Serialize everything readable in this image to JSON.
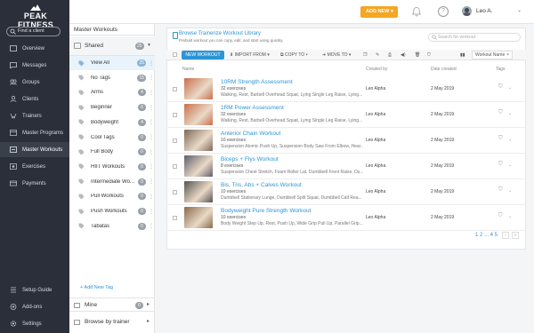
{
  "brand": {
    "name": "PEAK FITNESS",
    "accent": "#f5a623",
    "link": "#2c95d6",
    "sidebar_bg": "#2b2f3a"
  },
  "header": {
    "add_new_label": "ADD NEW",
    "user_name": "Leo A."
  },
  "sidebar": {
    "find_placeholder": "Find a client",
    "items": [
      {
        "label": "Overview",
        "icon": "overview-icon"
      },
      {
        "label": "Messages",
        "icon": "messages-icon"
      },
      {
        "label": "Groups",
        "icon": "groups-icon"
      },
      {
        "label": "Clients",
        "icon": "clients-icon"
      },
      {
        "label": "Trainers",
        "icon": "trainers-icon"
      },
      {
        "label": "Master Programs",
        "icon": "programs-icon"
      },
      {
        "label": "Master Workouts",
        "icon": "workouts-icon"
      },
      {
        "label": "Exercises",
        "icon": "exercises-icon"
      },
      {
        "label": "Payments",
        "icon": "payments-icon"
      }
    ],
    "bottom": [
      {
        "label": "Setup Guide",
        "icon": "setup-guide-icon"
      },
      {
        "label": "Add-ons",
        "icon": "addons-icon"
      },
      {
        "label": "Settings",
        "icon": "settings-icon"
      }
    ]
  },
  "tags_panel": {
    "title": "Master Workouts",
    "shared_label": "Shared",
    "shared_count": "25",
    "tags": [
      {
        "label": "View All",
        "count": "25"
      },
      {
        "label": "No Tags",
        "count": "15"
      },
      {
        "label": "Arms",
        "count": "4"
      },
      {
        "label": "Beginner",
        "count": "6"
      },
      {
        "label": "Bodyweight",
        "count": "4"
      },
      {
        "label": "Cool Tags",
        "count": "0"
      },
      {
        "label": "Full Body",
        "count": "0"
      },
      {
        "label": "HIIT Workouts",
        "count": "0"
      },
      {
        "label": "Intermediate Wo...",
        "count": "0"
      },
      {
        "label": "Pull Workouts",
        "count": "0"
      },
      {
        "label": "Push Workouts",
        "count": "0"
      },
      {
        "label": "Tabatas",
        "count": "0"
      }
    ],
    "add_tag_label": "+ Add New Tag",
    "mine_label": "Mine",
    "mine_count": "0",
    "browse_trainer_label": "Browse by trainer"
  },
  "library": {
    "link_text": "Browse Trainerize Workout Library",
    "subtitle": "Prebuilt workout you can copy, edit, and start using quickly.",
    "search_placeholder": "Search for workout"
  },
  "toolbar": {
    "new_workout": "NEW WORKOUT",
    "import_from": "IMPORT FROM",
    "copy_to": "COPY TO",
    "move_to": "MOVE TO",
    "sort_label": "Workout Name"
  },
  "columns": {
    "name": "Name",
    "created_by": "Created by",
    "date_created": "Date created",
    "tags": "Tags"
  },
  "rows": [
    {
      "title": "10RM Strength Assessment",
      "count": "32 exercises",
      "desc": "Walking, Rest, Barbell Overhead Squat, Lying Single Leg Raise, Lying...",
      "creator": "Leo Alpha",
      "date": "2 May 2019",
      "thumb": "#c96f4a"
    },
    {
      "title": "1RM Power Assessment",
      "count": "32 exercises",
      "desc": "Walking, Rest, Barbell Overhead Squat, Lying Single Leg Raise, Lying...",
      "creator": "Leo Alpha",
      "date": "2 May 2019",
      "thumb": "#c96f4a"
    },
    {
      "title": "Anterior Chain Workout",
      "count": "10 exercises",
      "desc": "Suspension Atomic Push Up, Suspension Body Saw From Elbow, Hear...",
      "creator": "Leo Alpha",
      "date": "2 May 2019",
      "thumb": "#7d6a57"
    },
    {
      "title": "Biceps + Flys Workout",
      "count": "8 exercises",
      "desc": "Suspension Chest Stretch, Foam Roller Lat, Dumbbell Front Raise, Du...",
      "creator": "Leo Alpha",
      "date": "2 May 2019",
      "thumb": "#5f5e6a"
    },
    {
      "title": "Bis, Tris, Abs + Calves Workout",
      "count": "10 exercises",
      "desc": "Dumbbell Stationary Lunge, Dumbbell Split Squat, Dumbbell Calf Rea...",
      "creator": "Leo Alpha",
      "date": "2 May 2019",
      "thumb": "#55534f"
    },
    {
      "title": "Bodyweight Pure Strength Workout",
      "count": "10 exercises",
      "desc": "Body Weight Step Up, Rest, Push Up, Wide Grip Pull Up, Parallel Grip...",
      "creator": "Leo Alpha",
      "date": "2 May 2019",
      "thumb": "#8a6a4a"
    }
  ],
  "pagination": {
    "pages": "1 2 ... 4 5"
  }
}
